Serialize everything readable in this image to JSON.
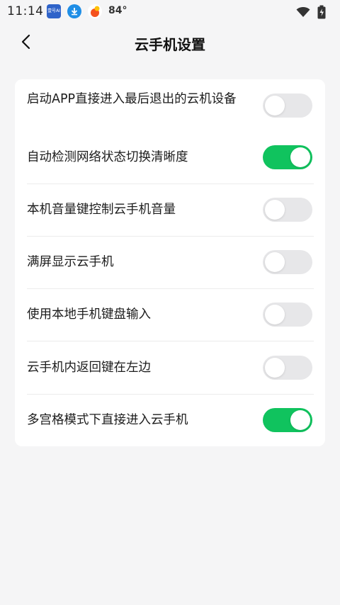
{
  "status_bar": {
    "time": "11:14",
    "app_icon_1_text": "壹号AI",
    "temperature": "84°"
  },
  "header": {
    "title": "云手机设置"
  },
  "settings": [
    {
      "label": "启动APP直接进入最后退出的云机设备",
      "enabled": false
    },
    {
      "label": "自动检测网络状态切换清晰度",
      "enabled": true
    },
    {
      "label": "本机音量键控制云手机音量",
      "enabled": false
    },
    {
      "label": "满屏显示云手机",
      "enabled": false
    },
    {
      "label": "使用本地手机键盘输入",
      "enabled": false
    },
    {
      "label": "云手机内返回键在左边",
      "enabled": false
    },
    {
      "label": "多宫格模式下直接进入云手机",
      "enabled": true
    }
  ],
  "colors": {
    "toggle_on": "#10c35e",
    "toggle_off": "#e7e7e9",
    "background": "#f5f5f6"
  }
}
